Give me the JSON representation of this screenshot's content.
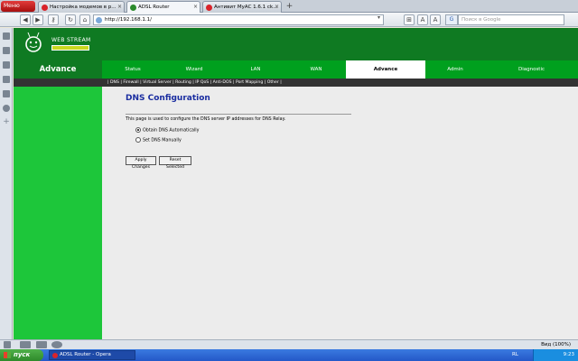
{
  "browser": {
    "menu_label": "Меню",
    "tabs": [
      {
        "title": "Настройка модемов в р...",
        "active": false
      },
      {
        "title": "ADSL Router",
        "active": true
      },
      {
        "title": "Антивит MyAC 1.6.1 сk...",
        "active": false
      }
    ],
    "address": "http://192.168.1.1/",
    "search_placeholder": "Поиск в Google",
    "zoom_label": "Вид (100%)"
  },
  "router": {
    "brand": "WEB STREAM",
    "section_title": "Advance",
    "nav": [
      "Status",
      "Wizard",
      "LAN",
      "WAN",
      "Advance",
      "Admin",
      "Diagnostic"
    ],
    "active_nav": "Advance",
    "subnav": "| DNS | Firewall | Virtual Server | Routing | IP QoS | Anti-DOS | Port Mapping | Other |",
    "page_title": "DNS Configuration",
    "description": "This page is used to configure the DNS server IP addresses for DNS Relay.",
    "options": [
      {
        "label": "Obtain DNS Automatically",
        "selected": true
      },
      {
        "label": "Set DNS Manually",
        "selected": false
      }
    ],
    "apply_label": "Apply Changes",
    "reset_label": "Reset Selected"
  },
  "taskbar": {
    "start_label": "пуск",
    "task": "ADSL Router - Opera",
    "lang": "RL",
    "clock": "9:23"
  },
  "colors": {
    "header_green": "#0f7a22",
    "nav_green": "#00a01e",
    "sidebar_green": "#1dc63a",
    "title_blue": "#1a2da0"
  }
}
